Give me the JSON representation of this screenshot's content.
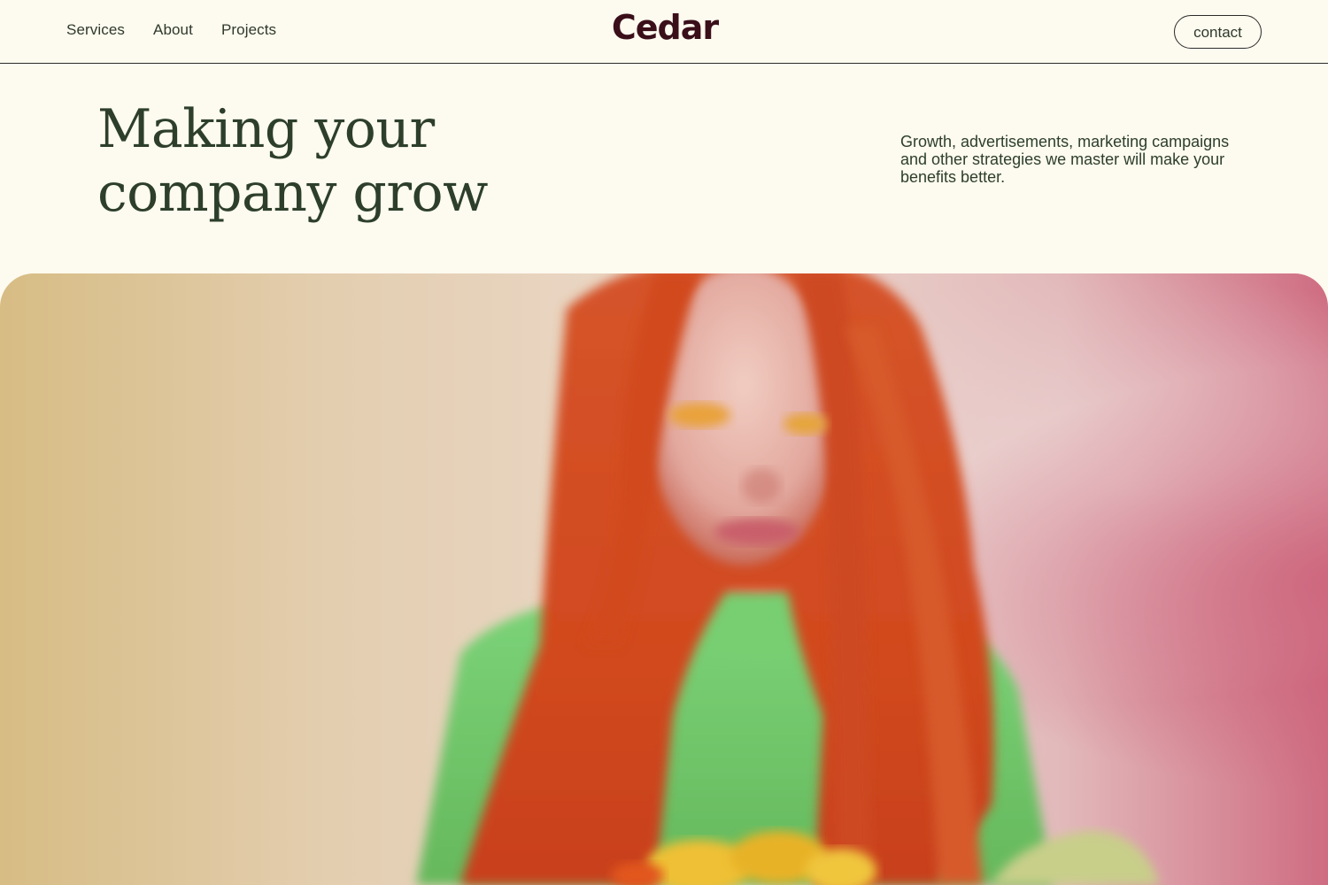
{
  "nav": {
    "items": [
      "Services",
      "About",
      "Projects"
    ]
  },
  "brand": {
    "name": "Cedar",
    "color": "#3a0f1a"
  },
  "header": {
    "contact_label": "contact"
  },
  "hero": {
    "headline_line1": "Making your",
    "headline_line2": "company grow",
    "intro": "Growth, advertisements, marketing campaigns and other strategies we master will make your benefits better.",
    "image_subject": "woman with long red hair in green top holding yellow flowers"
  },
  "colors": {
    "background": "#fdfaef",
    "text": "#2d3f2b",
    "accent_pink": "#d07085",
    "accent_tan": "#d9bf8c"
  }
}
